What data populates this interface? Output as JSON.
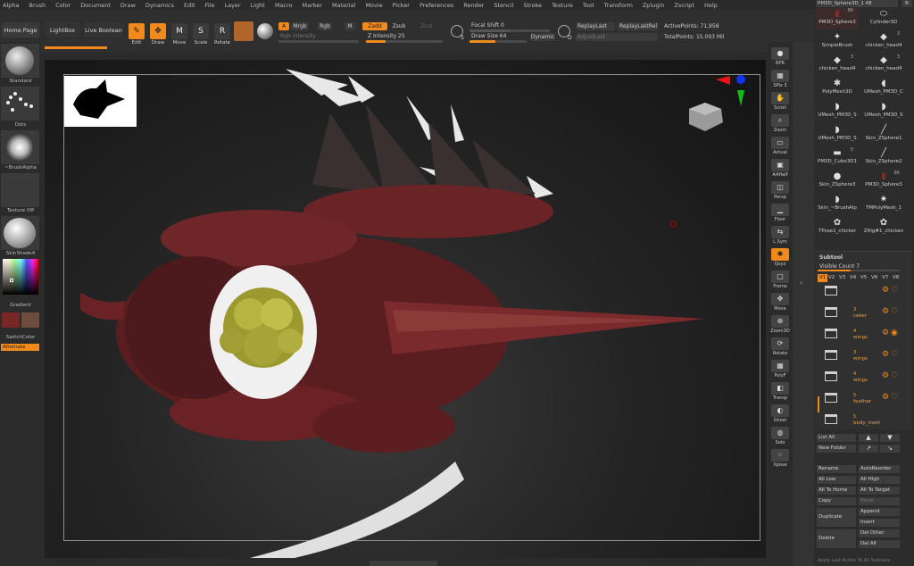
{
  "menu": [
    "Alpha",
    "Brush",
    "Color",
    "Document",
    "Draw",
    "Dynamics",
    "Edit",
    "File",
    "Layer",
    "Light",
    "Macro",
    "Marker",
    "Material",
    "Movie",
    "Picker",
    "Preferences",
    "Render",
    "Stencil",
    "Stroke",
    "Texture",
    "Tool",
    "Transform",
    "Zplugin",
    "Zscript",
    "Help"
  ],
  "toolbar": {
    "home_page": "Home Page",
    "lightbox": "LightBox",
    "live_boolean": "Live Boolean",
    "edit": "Edit",
    "draw": "Draw",
    "move": "Move",
    "scale": "Scale",
    "rotate": "Rotate",
    "a_chip": "A",
    "mrgb": "Mrgb",
    "rgb": "Rgb",
    "m": "M",
    "zadd": "Zadd",
    "zsub": "Zsub",
    "zcut": "Zcut",
    "rgb_intensity": "Rgb Intensity",
    "z_intensity": "Z Intensity 25",
    "focal_shift": "Focal Shift 0",
    "draw_size": "Draw Size 64",
    "dynamic": "Dynamic",
    "replay_last": "ReplayLast",
    "replay_last_rel": "ReplayLastRel",
    "adjust_last": "AdjustLast",
    "active_points": "ActivePoints: 71,958",
    "total_points": "TotalPoints: 15.093 Mil",
    "s_label": "S",
    "d_label": "D",
    "z_intensity_value": 25
  },
  "left": {
    "standard": "Standard",
    "dots": "Dots",
    "brush_alpha": "~BrushAlpha",
    "texture_off": "Texture Off",
    "material": "SkinShade4",
    "gradient": "Gradient",
    "switch_color": "SwitchColor",
    "alternate": "Alternate",
    "main_color": "#7a2626",
    "secondary_color": "#6d4b3d"
  },
  "right_shelf": [
    "BPR",
    "SPix 3",
    "Scroll",
    "Zoom",
    "Actual",
    "AAHalf",
    "Persp",
    "Floor",
    "L.Sym",
    "Qxyz",
    "Frame",
    "Move",
    "Zoom3D",
    "Rotate",
    "PolyF",
    "Transp",
    "Ghost",
    "Solo",
    "Xpose"
  ],
  "tools_header": "PM3D_Sphere3D_1  48",
  "tools_header_r": "R",
  "tools": [
    {
      "name": "PM3D_Sphere3",
      "count": "86"
    },
    {
      "name": "Cylinder3D",
      "count": ""
    },
    {
      "name": "SimpleBrush",
      "count": ""
    },
    {
      "name": "chicken_head4",
      "count": "3"
    },
    {
      "name": "chicken_head4",
      "count": "3"
    },
    {
      "name": "chicken_head4",
      "count": "3"
    },
    {
      "name": "PolyMesh3D",
      "count": ""
    },
    {
      "name": "UMesh_PM3D_C",
      "count": ""
    },
    {
      "name": "UMesh_PM3D_S",
      "count": ""
    },
    {
      "name": "UMesh_PM3D_S",
      "count": ""
    },
    {
      "name": "UMesh_PM3D_S",
      "count": ""
    },
    {
      "name": "Skin_ZSphere1",
      "count": ""
    },
    {
      "name": "PM3D_Cube3D1",
      "count": "5"
    },
    {
      "name": "Skin_ZSphere2",
      "count": ""
    },
    {
      "name": "Skin_ZSphere3",
      "count": ""
    },
    {
      "name": "PM3D_Sphere3",
      "count": "86"
    },
    {
      "name": "Skin_~BrushAlp",
      "count": ""
    },
    {
      "name": "TMPolyMesh_1",
      "count": ""
    },
    {
      "name": "TPose1_chicker",
      "count": ""
    },
    {
      "name": "ZRig#1_chicken",
      "count": ""
    }
  ],
  "subtool": {
    "title": "Subtool",
    "visible_count": "Visible Count 7",
    "tabs": [
      "V1",
      "V2",
      "V3",
      "V4",
      "V5",
      "V6",
      "V7",
      "V8"
    ],
    "rows": [
      {
        "count": "",
        "name": ""
      },
      {
        "count": "3",
        "name": "ceker"
      },
      {
        "count": "4",
        "name": "wings"
      },
      {
        "count": "3",
        "name": "wings"
      },
      {
        "count": "4",
        "name": "wings"
      },
      {
        "count": "5",
        "name": "feather"
      },
      {
        "count": "5",
        "name": "body_trash"
      }
    ]
  },
  "actions": {
    "list_all": "List All",
    "new_folder": "New Folder",
    "rename": "Rename",
    "auto_reorder": "AutoReorder",
    "all_low": "All Low",
    "all_high": "All High",
    "all_to_home": "All To Home",
    "all_to_target": "All To Target",
    "copy": "Copy",
    "paste": "Paste",
    "append": "Append",
    "duplicate": "Duplicate",
    "insert": "Insert",
    "delete": "Delete",
    "del_other": "Del Other",
    "del_all": "Del All",
    "apply_last": "Apply Last Action To All Subtools"
  }
}
